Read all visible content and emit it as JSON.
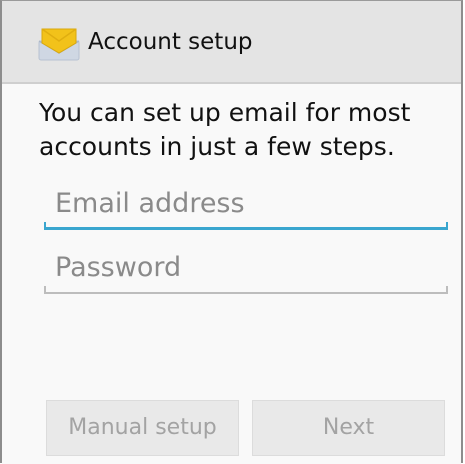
{
  "action_bar": {
    "title": "Account setup",
    "icon": "email-app-icon"
  },
  "main": {
    "intro_text": "You can set up email for most accounts in just a few steps.",
    "email_field": {
      "placeholder": "Email address",
      "value": "",
      "focused": true
    },
    "password_field": {
      "placeholder": "Password",
      "value": ""
    }
  },
  "buttons": {
    "manual_setup_label": "Manual setup",
    "next_label": "Next"
  },
  "colors": {
    "focus_accent": "#3aa6cf",
    "icon_yellow": "#f2c21a"
  }
}
